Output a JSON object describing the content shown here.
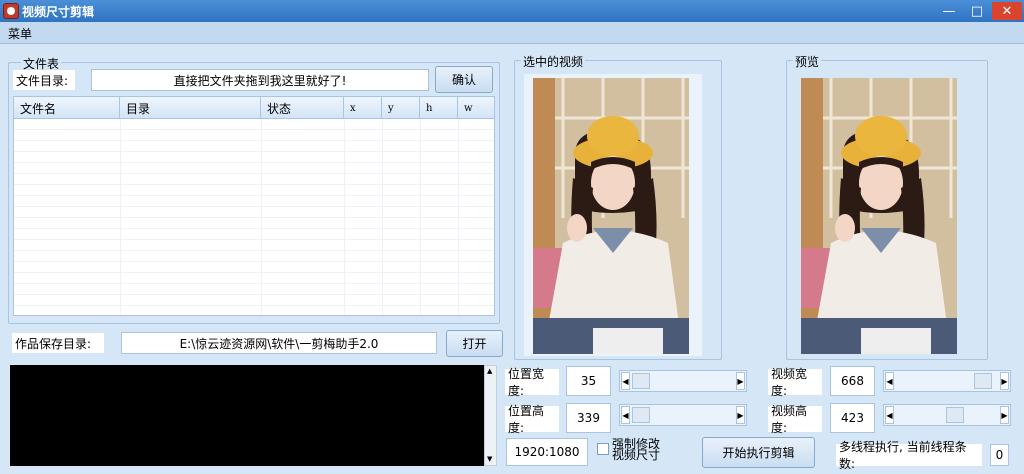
{
  "window": {
    "title": "视频尺寸剪辑",
    "minimize_glyph": "—",
    "maximize_glyph": "□",
    "close_glyph": "✕"
  },
  "menu": {
    "label": "菜单"
  },
  "file_group": {
    "label": "文件表",
    "dir_label": "文件目录:",
    "dir_value": "直接把文件夹拖到我这里就好了!",
    "confirm_button": "确认",
    "columns": [
      "文件名",
      "目录",
      "状态",
      "x",
      "y",
      "h",
      "w"
    ]
  },
  "save": {
    "label": "作品保存目录:",
    "path": "E:\\惊云迹资源网\\软件\\一剪梅助手2.0",
    "open_button": "打开"
  },
  "selected_video": {
    "label": "选中的视频"
  },
  "preview": {
    "label": "预览"
  },
  "position": {
    "width_label": "位置宽度:",
    "width_value": "35",
    "height_label": "位置高度:",
    "height_value": "339"
  },
  "video_size": {
    "width_label": "视频宽度:",
    "width_value": "668",
    "height_label": "视频高度:",
    "height_value": "423"
  },
  "resolution": "1920:1080",
  "force_modify": {
    "line1": "强制修改",
    "line2": "视频尺寸",
    "checked": false
  },
  "start_button": "开始执行剪辑",
  "thread": {
    "label": "多线程执行, 当前线程条数:",
    "count": "0"
  },
  "icons": {
    "app": "app-logo-icon",
    "arrow_left": "◀",
    "arrow_right": "▶",
    "arrow_up": "▲",
    "arrow_down": "▼"
  },
  "colors": {
    "background": "#d5e6f7",
    "titlebar": "#2f73c4",
    "close": "#d9442f",
    "console": "#000000"
  }
}
